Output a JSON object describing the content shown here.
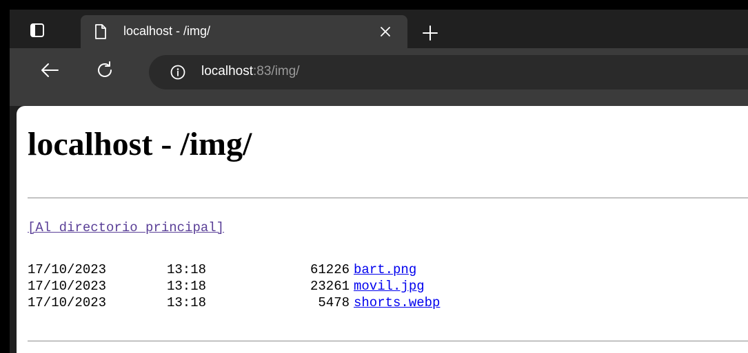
{
  "tab": {
    "title": "localhost - /img/"
  },
  "toolbar": {
    "url_host": "localhost",
    "url_rest": ":83/img/"
  },
  "page": {
    "heading": "localhost - /img/",
    "parent_link": "[Al directorio principal]",
    "files": [
      {
        "date": "17/10/2023",
        "time": "13:18",
        "size": "61226",
        "name": "bart.png"
      },
      {
        "date": "17/10/2023",
        "time": "13:18",
        "size": "23261",
        "name": "movil.jpg"
      },
      {
        "date": "17/10/2023",
        "time": "13:18",
        "size": "5478",
        "name": "shorts.webp"
      }
    ]
  },
  "icons": {
    "tab_actions": "tab-actions-icon",
    "favicon": "page-icon",
    "close": "close-icon",
    "new_tab": "plus-icon",
    "back": "back-arrow-icon",
    "reload": "reload-icon",
    "site_info": "info-icon"
  }
}
